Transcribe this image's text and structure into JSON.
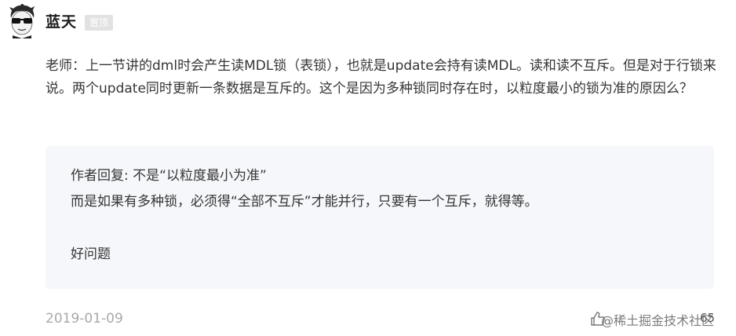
{
  "user": {
    "name": "蓝天",
    "badge": "置顶"
  },
  "comment": {
    "text": "老师：上一节讲的dml时会产生读MDL锁（表锁），也就是update会持有读MDL。读和读不互斥。但是对于行锁来说。两个update同时更新一条数据是互斥的。这个是因为多种锁同时存在时，以粒度最小的锁为准的原因么？"
  },
  "reply": {
    "line1": "作者回复: 不是“以粒度最小为准”",
    "line2": "而是如果有多种锁，必须得“全部不互斥”才能并行，只要有一个互斥，就得等。",
    "line3": "好问题"
  },
  "footer": {
    "date": "2019-01-09",
    "likes": "65",
    "watermark": "@稀土掘金技术社区"
  },
  "icons": {
    "avatar": "avatar-sunglasses",
    "like": "thumb-up-icon"
  }
}
